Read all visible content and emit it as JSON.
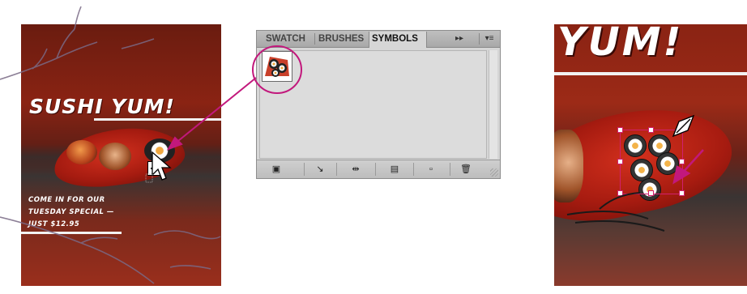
{
  "poster_left": {
    "title": "SUSHI YUM!",
    "promo_lines": [
      "COME IN FOR OUR",
      "TUESDAY SPECIAL —",
      "JUST $12.95"
    ]
  },
  "panel": {
    "tabs": [
      {
        "label": "SWATCH",
        "active": false
      },
      {
        "label": "BRUSHES",
        "active": false
      },
      {
        "label": "SYMBOLS",
        "active": true
      }
    ],
    "collapse_icon": "▸▸",
    "menu_icon": "▾≡",
    "bottom_buttons": [
      {
        "icon": "symbol-libraries-menu-icon",
        "glyph": "▣"
      },
      {
        "icon": "place-symbol-instance-icon",
        "glyph": "↘"
      },
      {
        "icon": "break-link-icon",
        "glyph": "⇹"
      },
      {
        "icon": "symbol-options-icon",
        "glyph": "▤"
      },
      {
        "icon": "new-symbol-icon",
        "glyph": "▫"
      },
      {
        "icon": "delete-symbol-icon",
        "glyph": "🗑"
      }
    ]
  },
  "poster_right": {
    "title": "YUM!"
  },
  "colors": {
    "poster_red": "#8a2313",
    "highlight_magenta": "#c2187c",
    "panel_gray": "#d6d6d6",
    "selection_pink": "#d0206e"
  }
}
